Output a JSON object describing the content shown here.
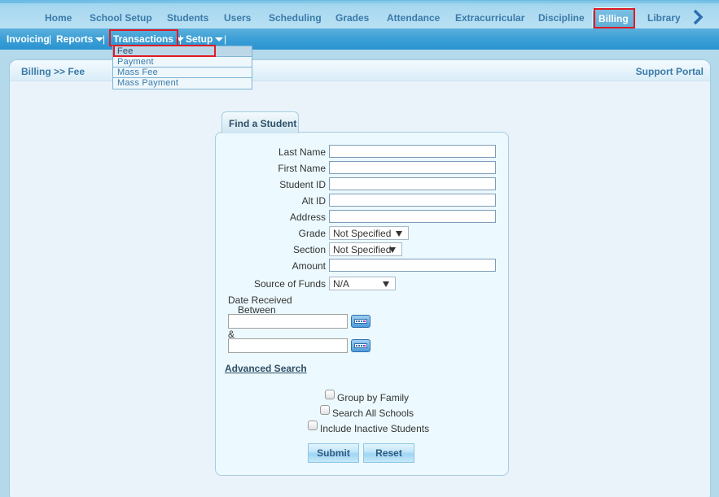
{
  "top_nav": {
    "items": [
      {
        "label": "Home"
      },
      {
        "label": "School Setup"
      },
      {
        "label": "Students"
      },
      {
        "label": "Users"
      },
      {
        "label": "Scheduling"
      },
      {
        "label": "Grades"
      },
      {
        "label": "Attendance"
      },
      {
        "label": "Extracurricular"
      },
      {
        "label": "Discipline"
      },
      {
        "label": "Billing",
        "active": true
      },
      {
        "label": "Library"
      }
    ],
    "more_icon": "chevron-right-icon"
  },
  "sub_nav": {
    "items": [
      {
        "label": "Invoicing",
        "has_dropdown": false
      },
      {
        "label": "Reports",
        "has_dropdown": true
      },
      {
        "label": "Transactions",
        "has_dropdown": true,
        "open": true
      },
      {
        "label": "Setup",
        "has_dropdown": true
      }
    ],
    "separator": "|"
  },
  "transactions_menu": {
    "items": [
      {
        "label": "Fee",
        "selected": true
      },
      {
        "label": "Payment"
      },
      {
        "label": "Mass Fee"
      },
      {
        "label": "Mass Payment"
      }
    ]
  },
  "page": {
    "breadcrumb": "Billing >> Fee",
    "support_link": "Support Portal"
  },
  "find_student": {
    "tab_label": "Find a Student",
    "fields": {
      "last_name": {
        "label": "Last Name",
        "value": ""
      },
      "first_name": {
        "label": "First Name",
        "value": ""
      },
      "student_id": {
        "label": "Student ID",
        "value": ""
      },
      "alt_id": {
        "label": "Alt ID",
        "value": ""
      },
      "address": {
        "label": "Address",
        "value": ""
      },
      "grade": {
        "label": "Grade",
        "value": "Not Specified"
      },
      "section": {
        "label": "Section",
        "value": "Not Specified"
      },
      "amount": {
        "label": "Amount",
        "value": ""
      },
      "source_of_funds": {
        "label": "Source of Funds",
        "value": "N/A"
      }
    },
    "date_received": {
      "label_line1": "Date Received",
      "label_line2": "Between",
      "and_label": "&",
      "from_value": "",
      "to_value": ""
    },
    "advanced_search": "Advanced Search",
    "checkboxes": [
      {
        "label": "Group by Family",
        "checked": false
      },
      {
        "label": "Search All Schools",
        "checked": false
      },
      {
        "label": "Include Inactive Students",
        "checked": false
      }
    ],
    "submit_label": "Submit",
    "reset_label": "Reset"
  },
  "colors": {
    "nav_text": "#3a7aa8",
    "highlight_box": "#e01b24",
    "subnav_bg": "#3c9fd6"
  }
}
